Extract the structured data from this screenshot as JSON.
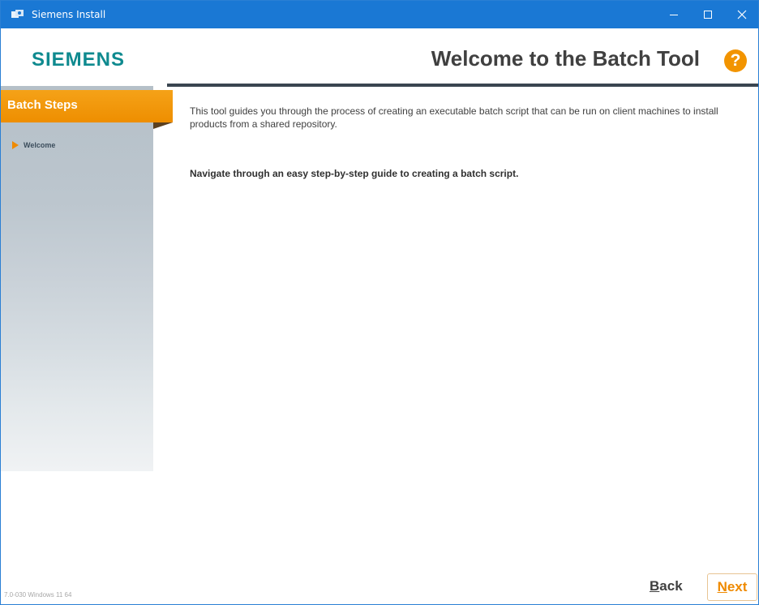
{
  "window": {
    "title": "Siemens Install",
    "icons": {
      "app": "siemens-install-icon",
      "minimize": "minimize-icon",
      "maximize": "maximize-icon",
      "close": "close-icon"
    }
  },
  "header": {
    "logo": "SIEMENS",
    "title": "Welcome to the Batch Tool",
    "help_symbol": "?",
    "colors": {
      "logo": "#0f8a8f",
      "accent": "#f29400"
    }
  },
  "sidebar": {
    "header": "Batch Steps",
    "steps": [
      {
        "label": "Welcome",
        "active": true
      }
    ]
  },
  "content": {
    "intro": "This tool guides you through the process of creating an executable batch script that can be run on client machines to install products from a shared repository.",
    "navigate": "Navigate through an easy step-by-step guide to creating a batch script."
  },
  "footer": {
    "version": "7.0-030  Windows 11 64",
    "back": {
      "mnemonic": "B",
      "rest": "ack"
    },
    "next": {
      "mnemonic": "N",
      "rest": "ext"
    }
  }
}
